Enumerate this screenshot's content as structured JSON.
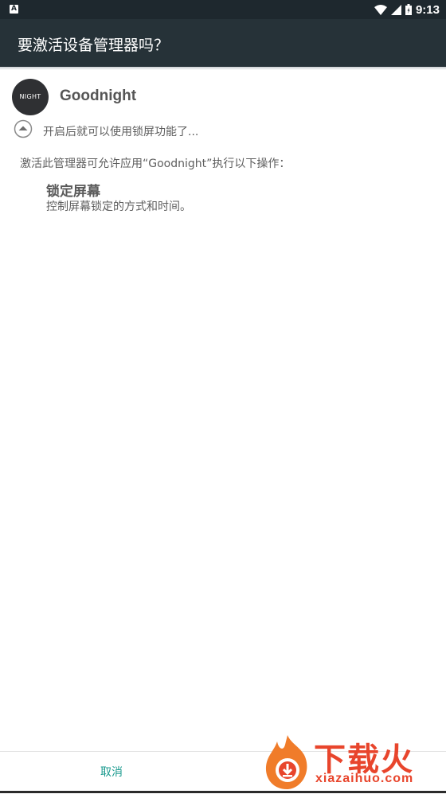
{
  "statusbar": {
    "notification_letter": "A",
    "time": "9:13"
  },
  "dialog": {
    "title": "要激活设备管理器吗？"
  },
  "app": {
    "icon_text": "NIGHT",
    "name": "Goodnight"
  },
  "description": "开启后就可以使用锁屏功能了...",
  "permission_intro": "激活此管理器可允许应用“Goodnight”执行以下操作：",
  "policy": {
    "title": "锁定屏幕",
    "description": "控制屏幕锁定的方式和时间。"
  },
  "buttons": {
    "cancel": "取消",
    "activate": ""
  },
  "watermark": {
    "text": "下载火",
    "url": "xiazaihuo.com"
  },
  "colors": {
    "accent": "#1a9a8e",
    "header": "#263238",
    "statusbar": "#1e282e",
    "watermark": "#e8452c"
  }
}
